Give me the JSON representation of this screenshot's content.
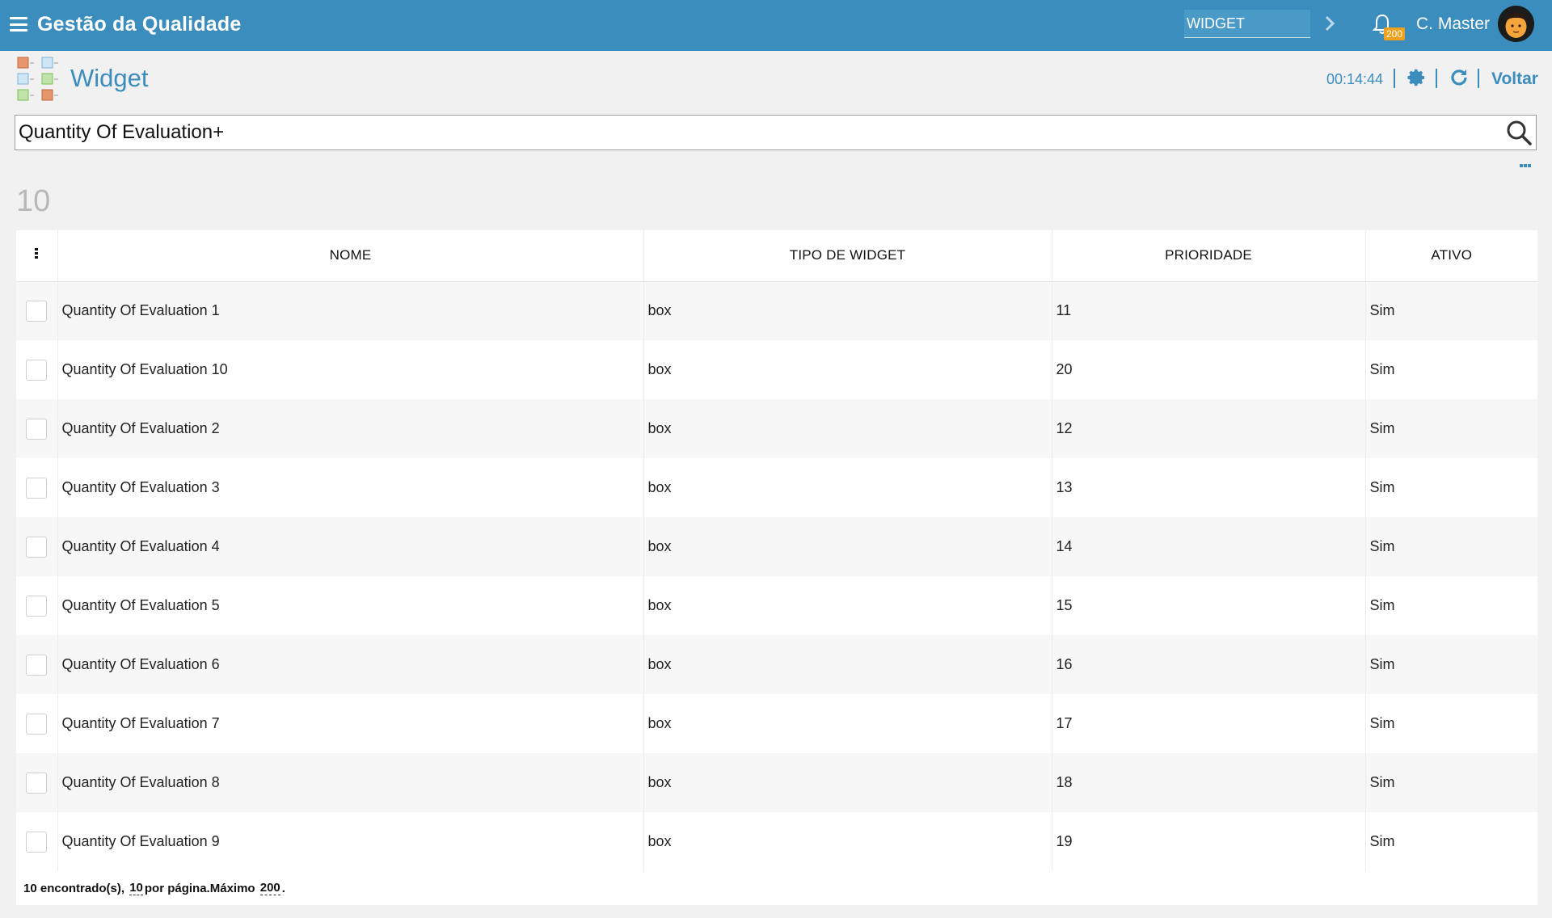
{
  "header": {
    "app_title": "Gestão da Qualidade",
    "module_value": "WIDGET",
    "notifications_count": "200",
    "user_name": "C. Master",
    "brand_color": "#3b8dbd",
    "badge_color": "#f0a01a"
  },
  "page": {
    "title": "Widget",
    "timer": "00:14:44",
    "back_label": "Voltar"
  },
  "search": {
    "value": "Quantity Of Evaluation+"
  },
  "summary": {
    "count": "10"
  },
  "table": {
    "columns": [
      "NOME",
      "TIPO DE WIDGET",
      "PRIORIDADE",
      "ATIVO"
    ],
    "rows": [
      {
        "nome": "Quantity Of Evaluation 1",
        "tipo": "box",
        "prioridade": "11",
        "ativo": "Sim"
      },
      {
        "nome": "Quantity Of Evaluation 10",
        "tipo": "box",
        "prioridade": "20",
        "ativo": "Sim"
      },
      {
        "nome": "Quantity Of Evaluation 2",
        "tipo": "box",
        "prioridade": "12",
        "ativo": "Sim"
      },
      {
        "nome": "Quantity Of Evaluation 3",
        "tipo": "box",
        "prioridade": "13",
        "ativo": "Sim"
      },
      {
        "nome": "Quantity Of Evaluation 4",
        "tipo": "box",
        "prioridade": "14",
        "ativo": "Sim"
      },
      {
        "nome": "Quantity Of Evaluation 5",
        "tipo": "box",
        "prioridade": "15",
        "ativo": "Sim"
      },
      {
        "nome": "Quantity Of Evaluation 6",
        "tipo": "box",
        "prioridade": "16",
        "ativo": "Sim"
      },
      {
        "nome": "Quantity Of Evaluation 7",
        "tipo": "box",
        "prioridade": "17",
        "ativo": "Sim"
      },
      {
        "nome": "Quantity Of Evaluation 8",
        "tipo": "box",
        "prioridade": "18",
        "ativo": "Sim"
      },
      {
        "nome": "Quantity Of Evaluation 9",
        "tipo": "box",
        "prioridade": "19",
        "ativo": "Sim"
      }
    ]
  },
  "footer": {
    "found_text": "10 encontrado(s),",
    "per_page_value": "10",
    "per_page_text": "por página.Máximo",
    "max_value": "200",
    "end_text": "."
  },
  "icons": {
    "menu": "hamburger-menu-icon",
    "module_next": "chevron-right-icon",
    "notifications": "bell-icon",
    "avatar": "user-avatar",
    "logo": "widget-grid-logo",
    "settings": "gear-icon",
    "refresh": "refresh-icon",
    "search": "search-icon",
    "more": "more-options-icon",
    "column_menu": "vertical-dots-icon"
  }
}
